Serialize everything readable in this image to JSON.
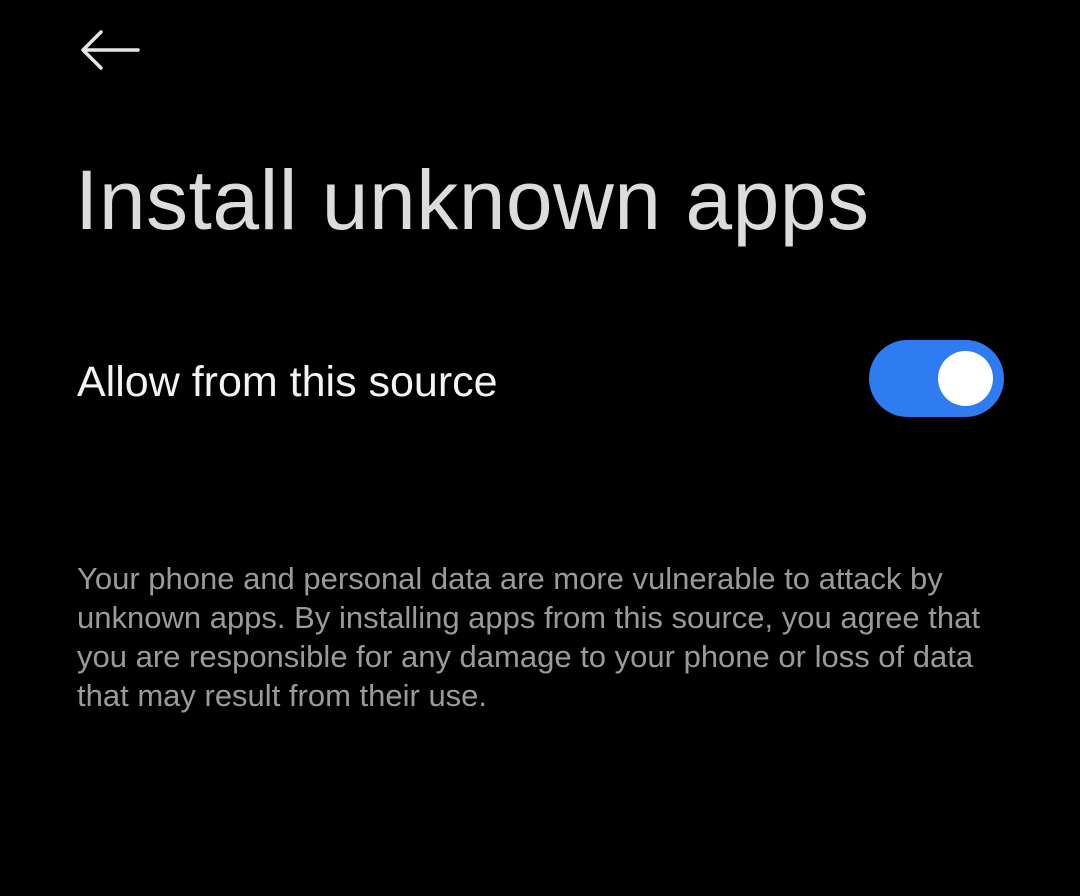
{
  "header": {
    "back_icon": "arrow-left-icon",
    "title": "Install unknown apps"
  },
  "setting": {
    "label": "Allow from this source",
    "toggle_state": "on",
    "toggle_color": "#2f7bf1"
  },
  "warning": {
    "text": "Your phone and personal data are more vulnerable to attack by unknown apps. By installing apps from this source, you agree that you are responsible for any damage to your phone or loss of data that may result from their use."
  },
  "colors": {
    "background": "#000000",
    "title": "#dcdcdc",
    "label": "#f3f3f3",
    "secondary_text": "#9a9a9a"
  }
}
